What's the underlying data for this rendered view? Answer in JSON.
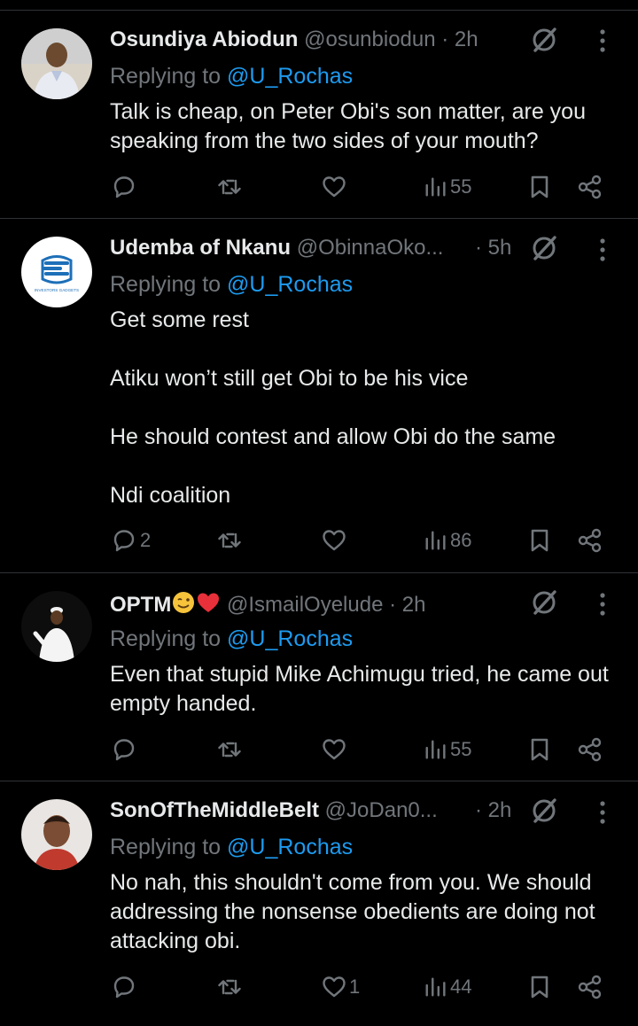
{
  "tweets": [
    {
      "name": "Osundiya Abiodun",
      "handle": "@osunbiodun",
      "time": "· 2h",
      "reply_prefix": "Replying to ",
      "reply_to": "@U_Rochas",
      "body": [
        "Talk is cheap, on Peter Obi's son matter, are you speaking from the two sides of your mouth?"
      ],
      "replies": "",
      "likes": "",
      "views": "55"
    },
    {
      "name": "Udemba of Nkanu",
      "handle": "@ObinnaOko...",
      "time": "· 5h",
      "reply_prefix": "Replying to ",
      "reply_to": "@U_Rochas",
      "avatar_text": "INVESTORS GADGETS",
      "body": [
        "Get some rest",
        "Atiku won’t still get Obi to be his vice",
        "He should contest and allow Obi do the same",
        "Ndi coalition"
      ],
      "replies": "2",
      "likes": "",
      "views": "86"
    },
    {
      "name": "OPTM",
      "handle": "@IsmailOyelude",
      "time": "· 2h",
      "reply_prefix": "Replying to ",
      "reply_to": "@U_Rochas",
      "body": [
        "Even that stupid Mike Achimugu tried, he came out empty handed."
      ],
      "replies": "",
      "likes": "",
      "views": "55"
    },
    {
      "name": "SonOfTheMiddleBelt",
      "handle": "@JoDan0...",
      "time": "· 2h",
      "reply_prefix": "Replying to ",
      "reply_to": "@U_Rochas",
      "body": [
        "No nah, this shouldn't come from you. We should addressing the nonsense obedients are doing not attacking obi."
      ],
      "replies": "",
      "likes": "1",
      "views": "44"
    }
  ],
  "icons": [
    "grok-icon",
    "more-icon",
    "reply-icon",
    "retweet-icon",
    "like-icon",
    "views-icon",
    "bookmark-icon",
    "share-icon"
  ],
  "colors": {
    "background": "#000000",
    "text": "#e7e9ea",
    "muted": "#71767b",
    "link": "#1d9bf0",
    "divider": "#2f3336"
  }
}
